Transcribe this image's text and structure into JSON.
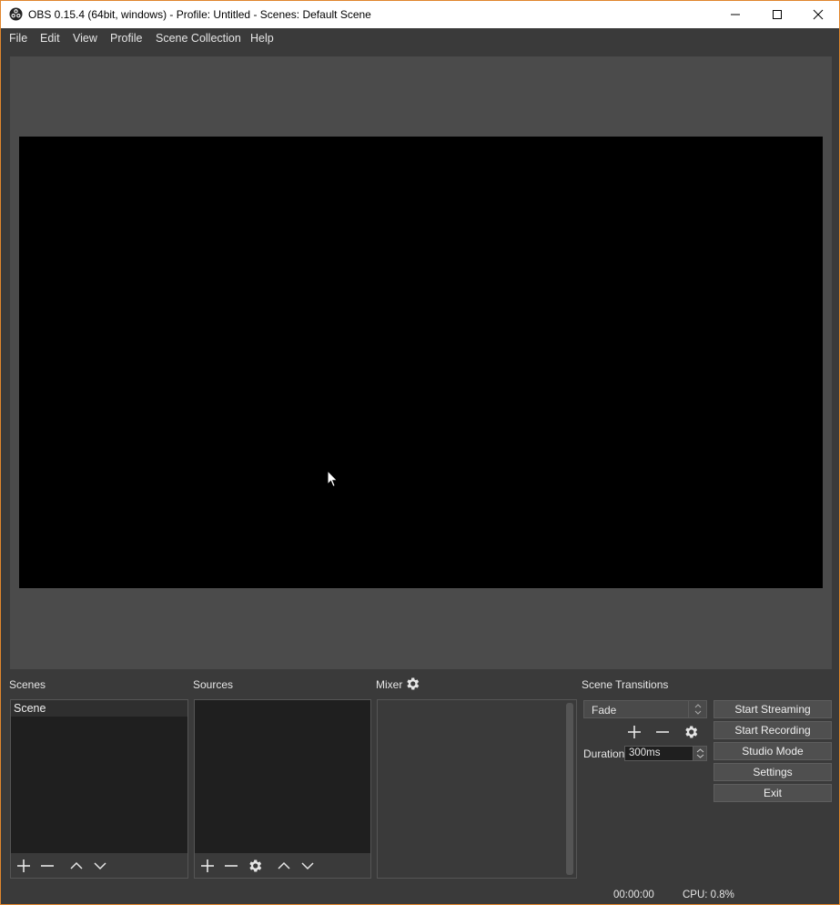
{
  "window": {
    "title": "OBS 0.15.4 (64bit, windows) - Profile: Untitled - Scenes: Default Scene",
    "accent_border": "#e0862e"
  },
  "menu": {
    "items": [
      "File",
      "Edit",
      "View",
      "Profile",
      "Scene Collection",
      "Help"
    ]
  },
  "docks": {
    "scenes_label": "Scenes",
    "sources_label": "Sources",
    "mixer_label": "Mixer",
    "transitions_label": "Scene Transitions"
  },
  "scenes": {
    "items": [
      "Scene"
    ]
  },
  "transitions": {
    "selected": "Fade",
    "duration_label": "Duration",
    "duration_value": "300ms"
  },
  "controls": {
    "start_streaming": "Start Streaming",
    "start_recording": "Start Recording",
    "studio_mode": "Studio Mode",
    "settings": "Settings",
    "exit": "Exit"
  },
  "status": {
    "time": "00:00:00",
    "cpu": "CPU: 0.8%"
  }
}
